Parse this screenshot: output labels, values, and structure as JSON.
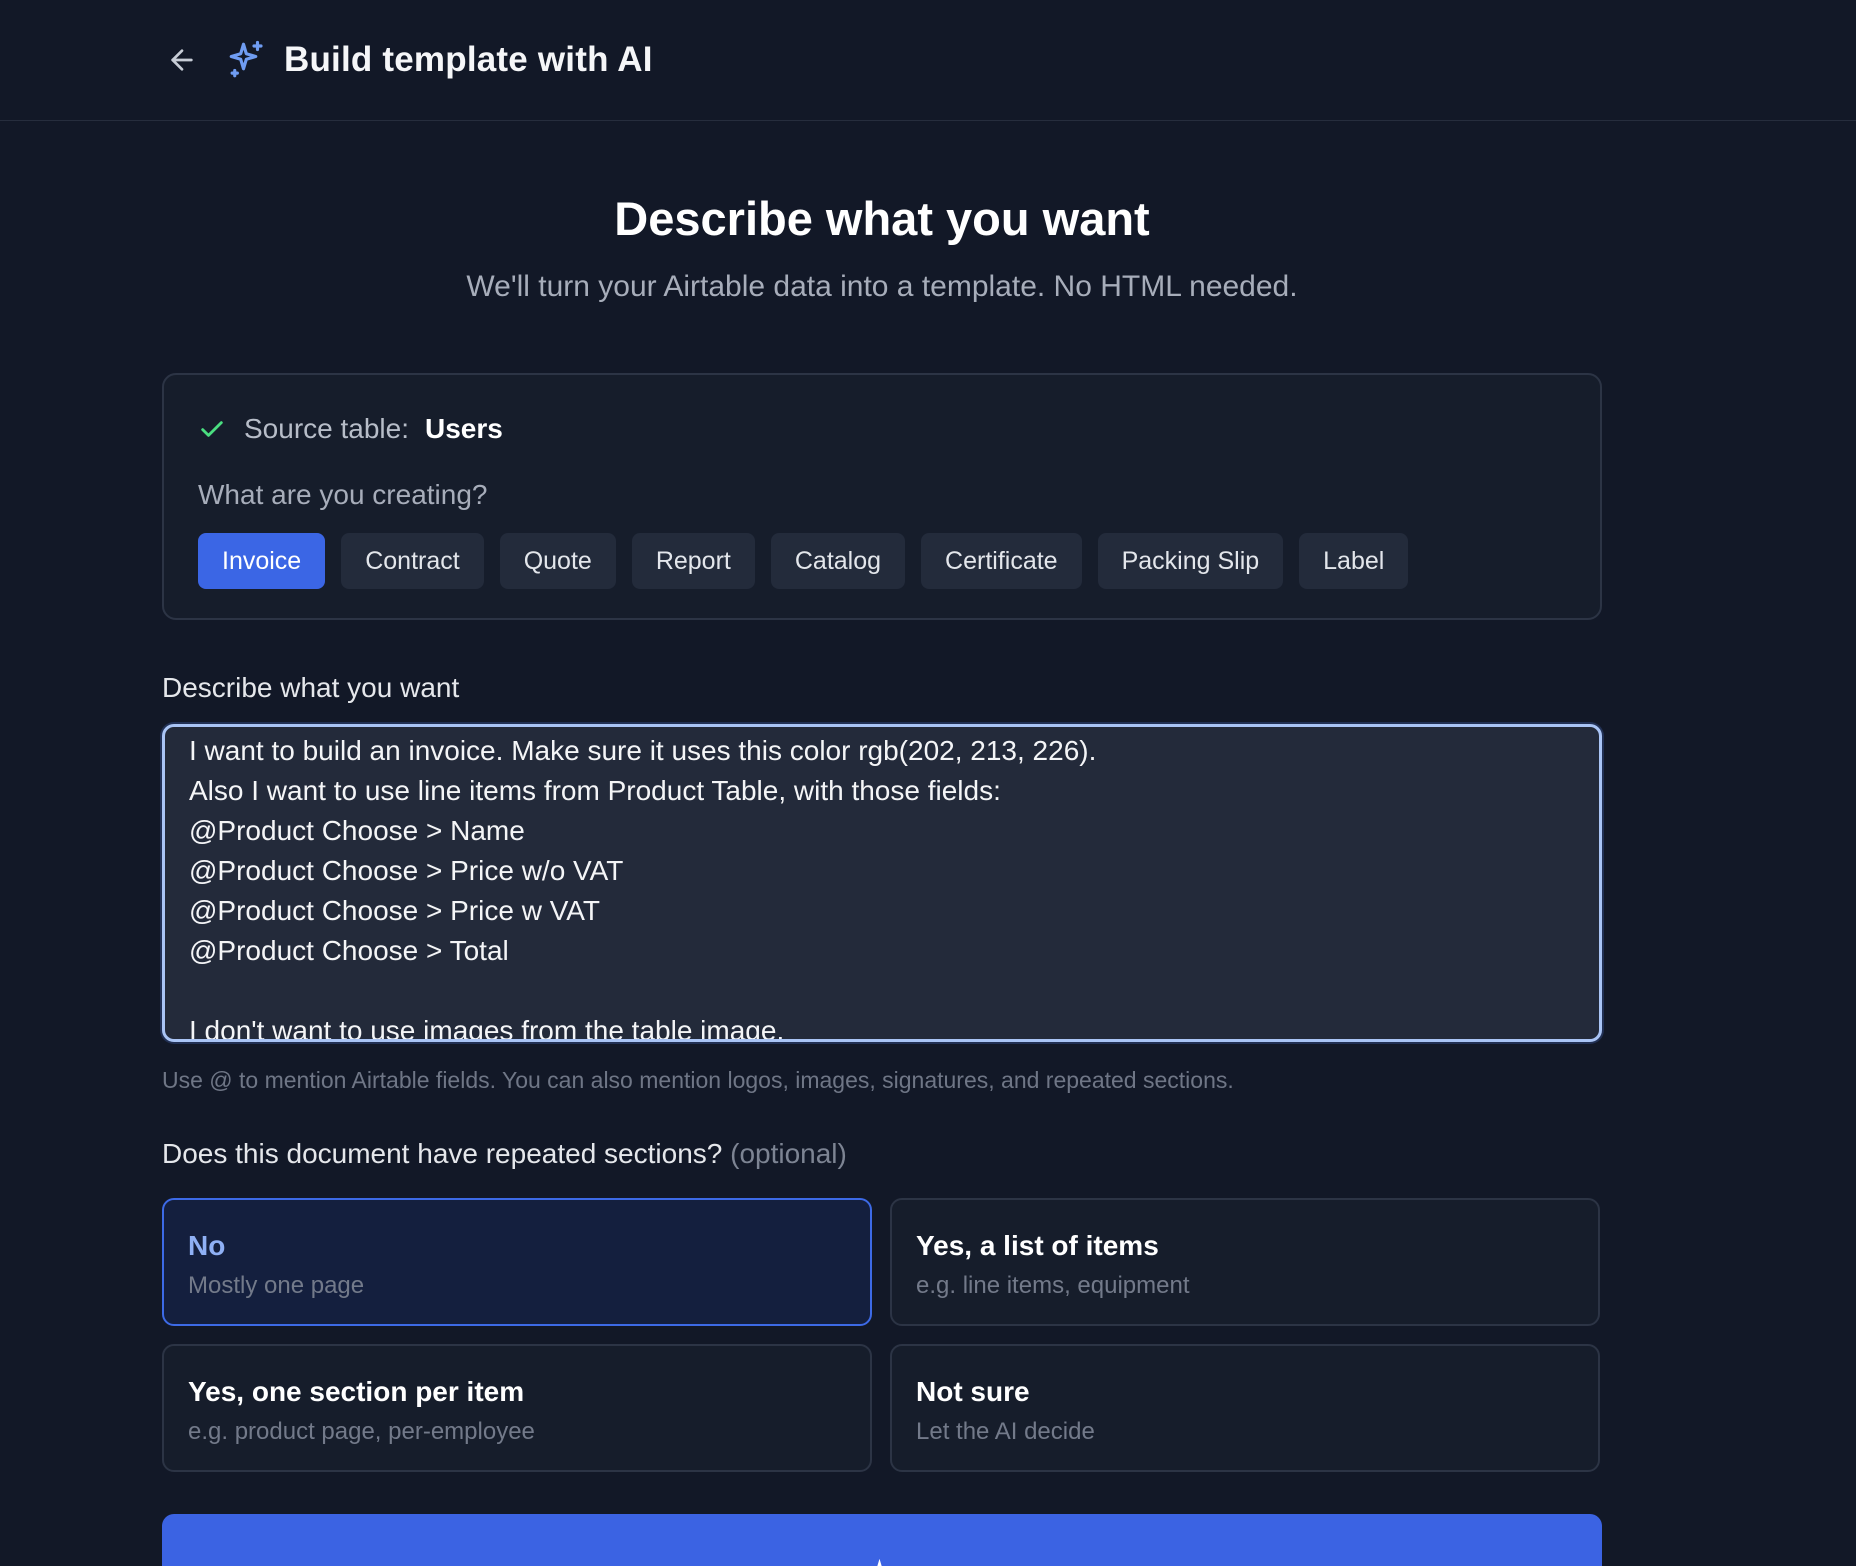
{
  "header": {
    "title": "Build template with AI"
  },
  "hero": {
    "title": "Describe what you want",
    "subtitle": "We'll turn your Airtable data into a template. No HTML needed."
  },
  "source": {
    "label": "Source table:",
    "value": "Users",
    "creating_label": "What are you creating?",
    "types": [
      "Invoice",
      "Contract",
      "Quote",
      "Report",
      "Catalog",
      "Certificate",
      "Packing Slip",
      "Label"
    ],
    "selected_type": "Invoice"
  },
  "description": {
    "label": "Describe what you want",
    "value": "I want to build an invoice. Make sure it uses this color rgb(202, 213, 226).\nAlso I want to use line items from Product Table, with those fields:\n@Product Choose > Name\n@Product Choose > Price w/o VAT\n@Product Choose > Price w VAT\n@Product Choose > Total\n\nI don't want to use images from the table image.",
    "helper": "Use @ to mention Airtable fields. You can also mention logos, images, signatures, and repeated sections."
  },
  "repeated": {
    "label": "Does this document have repeated sections?",
    "optional": "(optional)",
    "options": [
      {
        "title": "No",
        "desc": "Mostly one page",
        "selected": true
      },
      {
        "title": "Yes, a list of items",
        "desc": "e.g. line items, equipment",
        "selected": false
      },
      {
        "title": "Yes, one section per item",
        "desc": "e.g. product page, per-employee",
        "selected": false
      },
      {
        "title": "Not sure",
        "desc": "Let the AI decide",
        "selected": false
      }
    ]
  },
  "colors": {
    "accent": "#3b66e5",
    "success": "#4ade80",
    "background": "#121827"
  }
}
